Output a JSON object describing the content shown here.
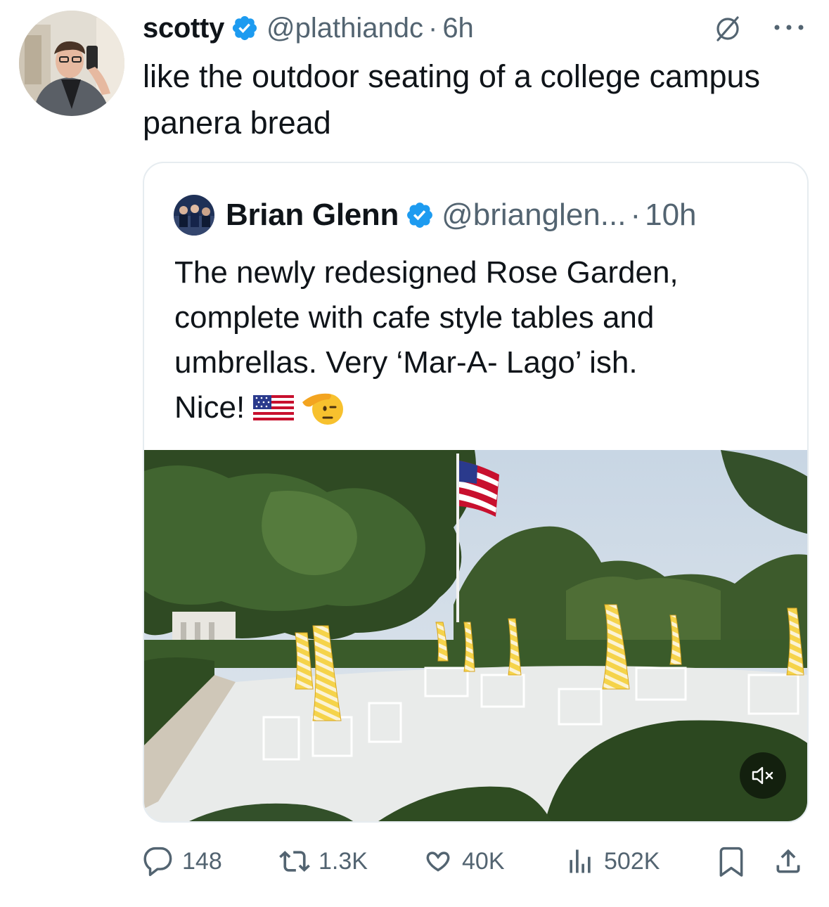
{
  "tweet": {
    "author_name": "scotty",
    "handle": "@plathiandc",
    "separator": "·",
    "time": "6h",
    "text": "like the outdoor seating of a college campus panera bread"
  },
  "quoted": {
    "author_name": "Brian Glenn",
    "handle": "@brianglen...",
    "separator": "·",
    "time": "10h",
    "text_line": "The newly redesigned Rose Garden, complete with cafe style tables and umbrellas. Very ‘Mar-A- Lago’ ish.",
    "text_nice": "Nice!"
  },
  "stats": {
    "replies": "148",
    "reposts": "1.3K",
    "likes": "40K",
    "views": "502K"
  },
  "icons": {
    "verified": "verified-badge-icon",
    "grok": "grok-icon",
    "more": "more-icon",
    "reply": "reply-icon",
    "repost": "repost-icon",
    "like": "heart-icon",
    "views": "views-icon",
    "bookmark": "bookmark-icon",
    "share": "share-icon",
    "mute": "muted-speaker-icon"
  },
  "colors": {
    "verified": "#1d9bf0",
    "text": "#0f1419",
    "secondary": "#536471",
    "border": "#e6ecf0"
  }
}
